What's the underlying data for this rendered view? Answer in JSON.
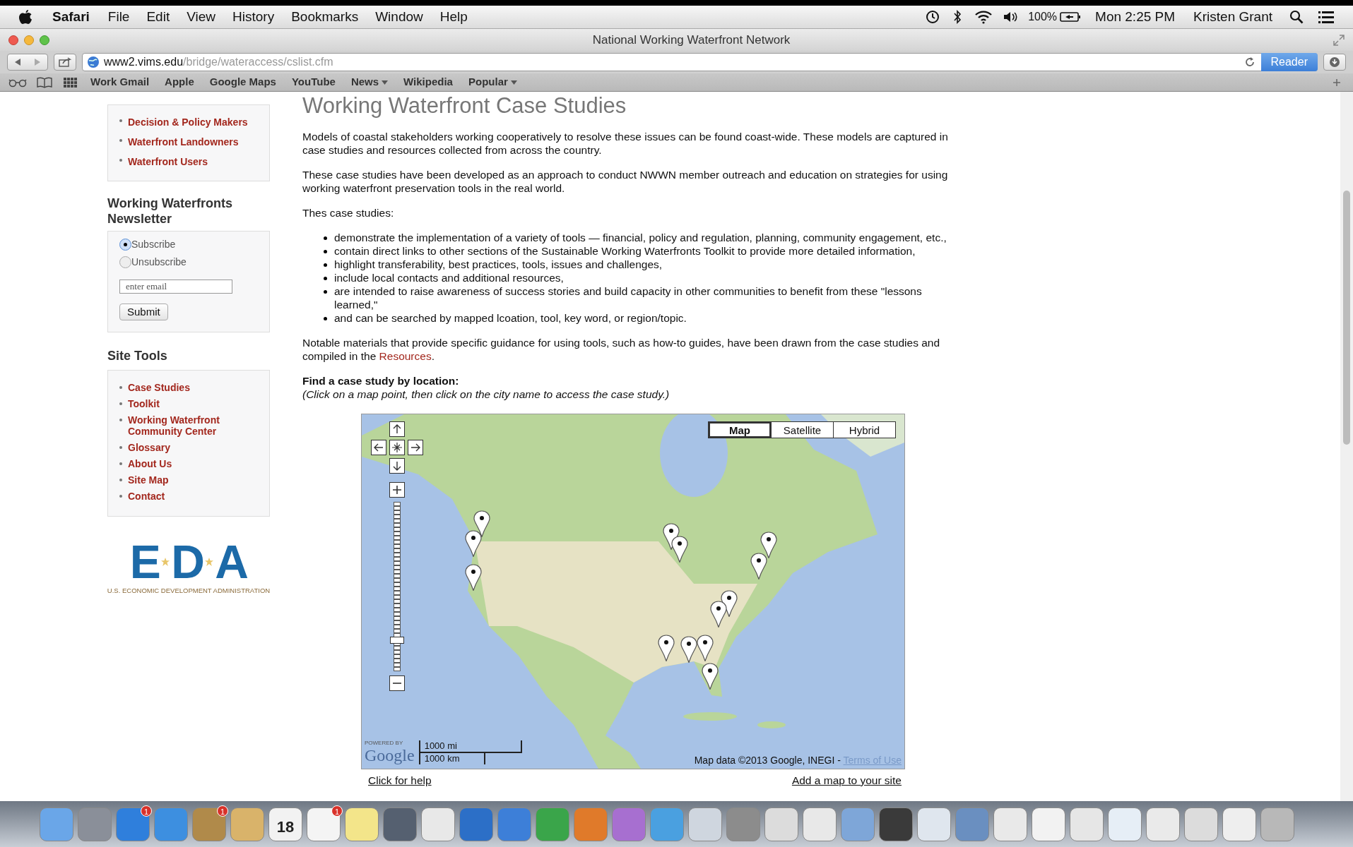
{
  "menubar": {
    "app": "Safari",
    "menus": [
      "File",
      "Edit",
      "View",
      "History",
      "Bookmarks",
      "Window",
      "Help"
    ],
    "battery": "100%",
    "clock": "Mon 2:25 PM",
    "user": "Kristen Grant"
  },
  "window": {
    "title": "National Working Waterfront Network"
  },
  "address_bar": {
    "domain": "www2.vims.edu",
    "path": "/bridge/wateraccess/cslist.cfm",
    "reader": "Reader"
  },
  "bookmarks": [
    {
      "label": "Work Gmail",
      "menu": false
    },
    {
      "label": "Apple",
      "menu": false
    },
    {
      "label": "Google Maps",
      "menu": false
    },
    {
      "label": "YouTube",
      "menu": false
    },
    {
      "label": "News",
      "menu": true
    },
    {
      "label": "Wikipedia",
      "menu": false
    },
    {
      "label": "Popular",
      "menu": true
    }
  ],
  "sidebar": {
    "audience_links": [
      "Decision & Policy Makers",
      "Waterfront Landowners",
      "Waterfront Users"
    ],
    "newsletter": {
      "title": "Working Waterfronts Newsletter",
      "options": [
        {
          "label": "Subscribe",
          "selected": true
        },
        {
          "label": "Unsubscribe",
          "selected": false
        }
      ],
      "email_placeholder": "enter email",
      "submit": "Submit"
    },
    "site_tools": {
      "title": "Site Tools",
      "links": [
        "Case Studies",
        "Toolkit",
        "Working Waterfront Community Center",
        "Glossary",
        "About Us",
        "Site Map",
        "Contact"
      ]
    },
    "logo": {
      "letters": [
        "E",
        "D",
        "A"
      ],
      "caption": "U.S. ECONOMIC DEVELOPMENT ADMINISTRATION"
    }
  },
  "main": {
    "title": "Working Waterfront Case Studies",
    "paragraphs": [
      "Models of coastal stakeholders working cooperatively to resolve these issues can be found coast-wide. These models are captured in case studies and resources collected from across the country.",
      "These case studies have been developed as an approach to conduct NWWN member outreach and education on strategies for using working waterfront preservation tools in the real world.",
      "Thes case studies:"
    ],
    "bullets": [
      "demonstrate the implementation of a variety of tools — financial, policy and regulation, planning, community engagement, etc.,",
      "contain direct links to other sections of the Sustainable Working Waterfronts Toolkit to provide more detailed information,",
      "highlight transferability, best practices, tools, issues and challenges,",
      "include local contacts and additional resources,",
      "are intended to raise awareness of success stories and build capacity in other communities to benefit from these \"lessons learned,\"",
      "and can be searched by mapped lcoation, tool, key word, or region/topic."
    ],
    "notable": "Notable materials that provide specific guidance for using tools, such as how-to guides, have been drawn from the case studies and compiled in the ",
    "notable_link": "Resources",
    "notable_end": ".",
    "find_heading": "Find a case study by location:",
    "find_hint": "(Click on a map point, then click on the city name to access the case study.)"
  },
  "map": {
    "types": [
      {
        "label": "Map",
        "selected": true
      },
      {
        "label": "Satellite",
        "selected": false
      },
      {
        "label": "Hybrid",
        "selected": false
      }
    ],
    "zoom": {
      "level": 0.17
    },
    "scale": [
      "1000 mi",
      "1000 km"
    ],
    "powered_by": "POWERED BY",
    "google": "Google",
    "attribution": "Map data ©2013 Google, INEGI - ",
    "terms": "Terms of Use"
  },
  "map_links": [
    "Click for help",
    "Add a map to your site"
  ],
  "dock": {
    "calendar_day": "18",
    "badges": [
      "1",
      "1",
      "1"
    ]
  }
}
